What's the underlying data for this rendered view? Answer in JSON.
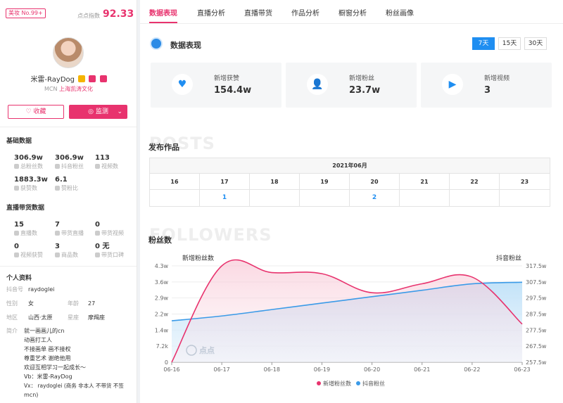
{
  "profile": {
    "rank_badge": "美妆 No.99+",
    "score_label": "点点指数",
    "score": "92.33",
    "name": "米雷-RayDog",
    "mcn_label": "MCN",
    "mcn_name": "上海凯涛文化",
    "fav_button": "收藏",
    "monitor_button": "监测",
    "monitor_caret": "⌄"
  },
  "basic": {
    "title": "基础数据",
    "stats": [
      {
        "value": "306.9w",
        "label": "总粉丝数"
      },
      {
        "value": "306.9w",
        "label": "抖音粉丝"
      },
      {
        "value": "113",
        "label": "视频数"
      },
      {
        "value": "1883.3w",
        "label": "获赞数"
      },
      {
        "value": "6.1",
        "label": "赞粉比"
      }
    ]
  },
  "live": {
    "title": "直播带货数据",
    "stats": [
      {
        "value": "15",
        "label": "直播数"
      },
      {
        "value": "7",
        "label": "带货直播"
      },
      {
        "value": "0",
        "label": "带货视频"
      },
      {
        "value": "0",
        "label": "视频获赞"
      },
      {
        "value": "3",
        "label": "商品数"
      },
      {
        "value": "0 无",
        "label": "带货口碑"
      }
    ]
  },
  "personal": {
    "title": "个人资料",
    "douyin_label": "抖音号",
    "douyin_value": "raydoglei",
    "gender_label": "性别",
    "gender_value": "女",
    "age_label": "年龄",
    "age_value": "27",
    "region_label": "地区",
    "region_value": "山西·太原",
    "sign_label": "星座",
    "sign_value": "摩羯座",
    "bio_label": "简介",
    "bio_lines": [
      "就一画画儿的cn",
      "动画打工人",
      "不接画单 画不接权",
      "尊重艺术 谢绝他用",
      "欢迎互相学习一起成长～",
      "Vb：米雷-RayDog",
      "Vx： raydoglei (商务 非本人 不带货 不签",
      "mcn)"
    ]
  },
  "tabs": [
    "数据表现",
    "直播分析",
    "直播带货",
    "作品分析",
    "橱窗分析",
    "粉丝画像"
  ],
  "performance": {
    "title": "数据表现",
    "ranges": [
      "7天",
      "15天",
      "30天"
    ],
    "cards": [
      {
        "icon": "heart-icon",
        "label": "新增获赞",
        "value": "154.4w"
      },
      {
        "icon": "user-plus-icon",
        "label": "新增粉丝",
        "value": "23.7w"
      },
      {
        "icon": "play-icon",
        "label": "新增视频",
        "value": "3"
      }
    ]
  },
  "posts": {
    "watermark": "POSTS",
    "title": "发布作品",
    "month": "2021年06月",
    "days": [
      "16",
      "17",
      "18",
      "19",
      "20",
      "21",
      "22",
      "23"
    ],
    "counts": [
      "",
      "1",
      "",
      "",
      "2",
      "",
      "",
      ""
    ]
  },
  "followers": {
    "watermark": "FOLLOWERS",
    "title": "粉丝数",
    "left_axis_name": "新增粉丝数",
    "right_axis_name": "抖音粉丝",
    "logo_text": "点点"
  },
  "chart_data": {
    "type": "line",
    "x": [
      "06-16",
      "06-17",
      "06-18",
      "06-19",
      "06-20",
      "06-21",
      "06-22",
      "06-23"
    ],
    "y_left_ticks": [
      "0",
      "7.2k",
      "1.4w",
      "2.2w",
      "2.9w",
      "3.6w",
      "4.3w"
    ],
    "y_right_ticks": [
      "257.5w",
      "267.5w",
      "277.5w",
      "287.5w",
      "297.5w",
      "307.5w",
      "317.5w"
    ],
    "y_left_range": [
      0,
      43000
    ],
    "y_right_range": [
      2575000,
      3175000
    ],
    "series": [
      {
        "name": "新增粉丝数",
        "axis": "left",
        "color": "#e8336e",
        "values": [
          0,
          43000,
          40000,
          39500,
          31000,
          35000,
          38000,
          17000
        ]
      },
      {
        "name": "抖音粉丝",
        "axis": "right",
        "color": "#3b9be8",
        "values": [
          2833000,
          2863000,
          2903000,
          2943000,
          2983000,
          3023000,
          3063000,
          3073000
        ]
      }
    ],
    "legend_position": "bottom-center"
  }
}
